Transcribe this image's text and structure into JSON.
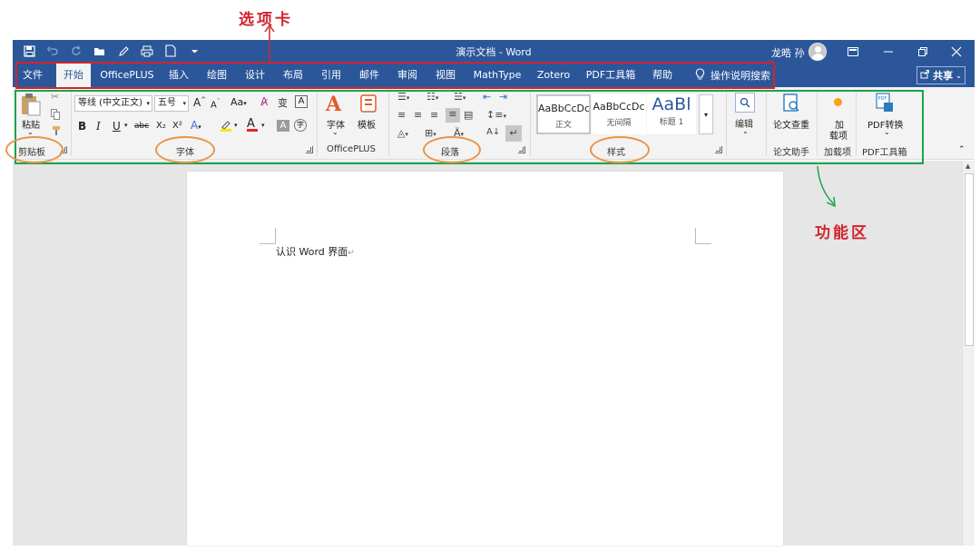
{
  "annotations": {
    "tabs_label": "选项卡",
    "ribbon_label": "功能区",
    "colors": {
      "tabs_box": "#d1242f",
      "ribbon_box": "#1aa34a",
      "ovals": "#e8954a",
      "label_text": "#d1242f",
      "arrow_red": "#d1242f",
      "arrow_green": "#1aa34a"
    }
  },
  "titlebar": {
    "doc_title": "演示文档 - Word",
    "user_name": "龙晧 孙",
    "accent": "#2b579a",
    "qat_icons": [
      "save-icon",
      "undo-icon",
      "redo-icon",
      "open-icon",
      "draw-icon",
      "print-icon",
      "new-doc-icon",
      "customize-icon"
    ]
  },
  "tabs": {
    "items": [
      "文件",
      "开始",
      "OfficePLUS",
      "插入",
      "绘图",
      "设计",
      "布局",
      "引用",
      "邮件",
      "审阅",
      "视图",
      "MathType",
      "Zotero",
      "PDF工具箱",
      "帮助"
    ],
    "active": "开始",
    "search": "操作说明搜索",
    "share": "共享"
  },
  "ribbon": {
    "clipboard": {
      "label": "剪贴板",
      "paste": "粘贴"
    },
    "font": {
      "label": "字体",
      "font_name": "等线 (中文正文)",
      "font_size": "五号",
      "aa": "Aa",
      "phonetic": "变",
      "bold": "B",
      "italic": "I",
      "underline": "U",
      "strike": "abc",
      "subscript": "X₂",
      "superscript": "X²",
      "boxed": "A"
    },
    "officeplus": {
      "label": "OfficePLUS",
      "font_btn": "字体",
      "template_btn": "模板"
    },
    "paragraph": {
      "label": "段落"
    },
    "styles": {
      "label": "样式",
      "items": [
        {
          "sample": "AaBbCcDc",
          "name": "正文"
        },
        {
          "sample": "AaBbCcDc",
          "name": "无间隔"
        },
        {
          "sample": "AaBl",
          "name": "标题 1"
        }
      ]
    },
    "editing": {
      "label": "编辑"
    },
    "paper_check": {
      "label": "论文助手",
      "btn": "论文查重"
    },
    "addins": {
      "label": "加载项",
      "btn_line1": "加",
      "btn_line2": "载项"
    },
    "pdf": {
      "label": "PDF工具箱",
      "btn": "PDF转换"
    }
  },
  "document": {
    "text": "认识 Word 界面"
  }
}
